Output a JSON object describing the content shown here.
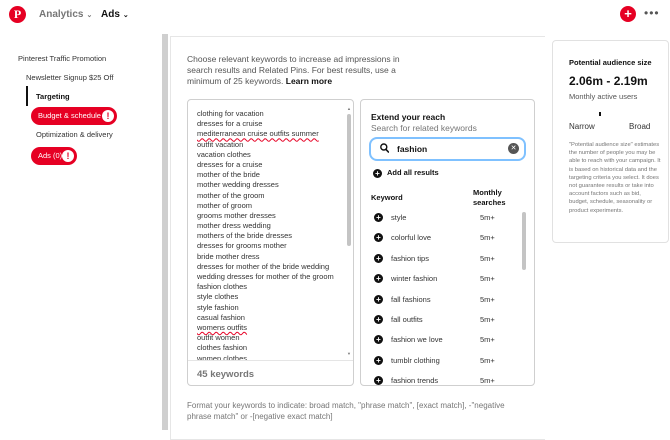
{
  "topbar": {
    "logo_glyph": "P",
    "nav": [
      {
        "label": "Analytics"
      },
      {
        "label": "Ads"
      }
    ],
    "chevron": "⌄",
    "create_glyph": "+",
    "more_glyph": "•••",
    "brand_color": "#e60023"
  },
  "sidebar": {
    "campaign": "Pinterest Traffic Promotion",
    "ad_group": "Newsletter Signup $25 Off",
    "targeting": "Targeting",
    "budget": "Budget & schedule",
    "optimization": "Optimization & delivery",
    "ads": "Ads (0)",
    "warn_glyph": "!"
  },
  "main": {
    "intro_text": "Choose relevant keywords to increase ad impressions in search results and Related Pins. For best results, use a minimum of 25 keywords.",
    "learn_more": "Learn more",
    "keywords": [
      {
        "text": "clothing for vacation",
        "spell": false
      },
      {
        "text": "dresses for a cruise",
        "spell": false
      },
      {
        "text": "mediterranean cruise outfits summer",
        "spell": true
      },
      {
        "text": "outfit vacation",
        "spell": false
      },
      {
        "text": "vacation clothes",
        "spell": false
      },
      {
        "text": "dresses for a cruise",
        "spell": false
      },
      {
        "text": "mother of the bride",
        "spell": false
      },
      {
        "text": "mother wedding dresses",
        "spell": false
      },
      {
        "text": "mother of the groom",
        "spell": false
      },
      {
        "text": "mother of groom",
        "spell": false
      },
      {
        "text": "grooms mother dresses",
        "spell": false
      },
      {
        "text": "mother dress wedding",
        "spell": false
      },
      {
        "text": "mothers of the bride dresses",
        "spell": false
      },
      {
        "text": "dresses for grooms mother",
        "spell": false
      },
      {
        "text": "bride mother dress",
        "spell": false
      },
      {
        "text": "dresses for mother of the bride wedding",
        "spell": false
      },
      {
        "text": "wedding dresses for mother of the groom",
        "spell": false
      },
      {
        "text": "fashion clothes",
        "spell": false
      },
      {
        "text": "style clothes",
        "spell": false
      },
      {
        "text": "style fashion",
        "spell": false
      },
      {
        "text": "casual fashion",
        "spell": false
      },
      {
        "text": "womens outfits",
        "spell": true
      },
      {
        "text": "outfit women",
        "spell": false
      },
      {
        "text": "clothes fashion",
        "spell": false
      },
      {
        "text": "women clothes",
        "spell": false
      }
    ],
    "keyword_count": "45 keywords",
    "extend": {
      "title": "Extend your reach",
      "subtitle": "Search for related keywords",
      "search_value": "fashion",
      "clear_glyph": "✕",
      "add_all": "Add all results",
      "plus_glyph": "+",
      "col_keyword": "Keyword",
      "col_searches": "Monthly searches",
      "rows": [
        {
          "keyword": "style",
          "searches": "5m+"
        },
        {
          "keyword": "colorful love",
          "searches": "5m+"
        },
        {
          "keyword": "fashion tips",
          "searches": "5m+"
        },
        {
          "keyword": "winter fashion",
          "searches": "5m+"
        },
        {
          "keyword": "fall fashions",
          "searches": "5m+"
        },
        {
          "keyword": "fall outfits",
          "searches": "5m+"
        },
        {
          "keyword": "fashion we love",
          "searches": "5m+"
        },
        {
          "keyword": "tumblr clothing",
          "searches": "5m+"
        },
        {
          "keyword": "fashion trends",
          "searches": "5m+"
        }
      ]
    },
    "format_hint": "Format your keywords to indicate: broad match, \"phrase match\", [exact match], -\"negative phrase match\" or -[negative exact match]"
  },
  "audience": {
    "title": "Potential audience size",
    "range": "2.06m - 2.19m",
    "subtitle": "Monthly active users",
    "narrow": "Narrow",
    "broad": "Broad",
    "note": "\"Potential audience size\" estimates the number of people you may be able to reach with your campaign. It is based on historical data and the targeting criteria you select. It does not guarantee results or take into account factors such as bid, budget, schedule, seasonality or product experiments."
  }
}
